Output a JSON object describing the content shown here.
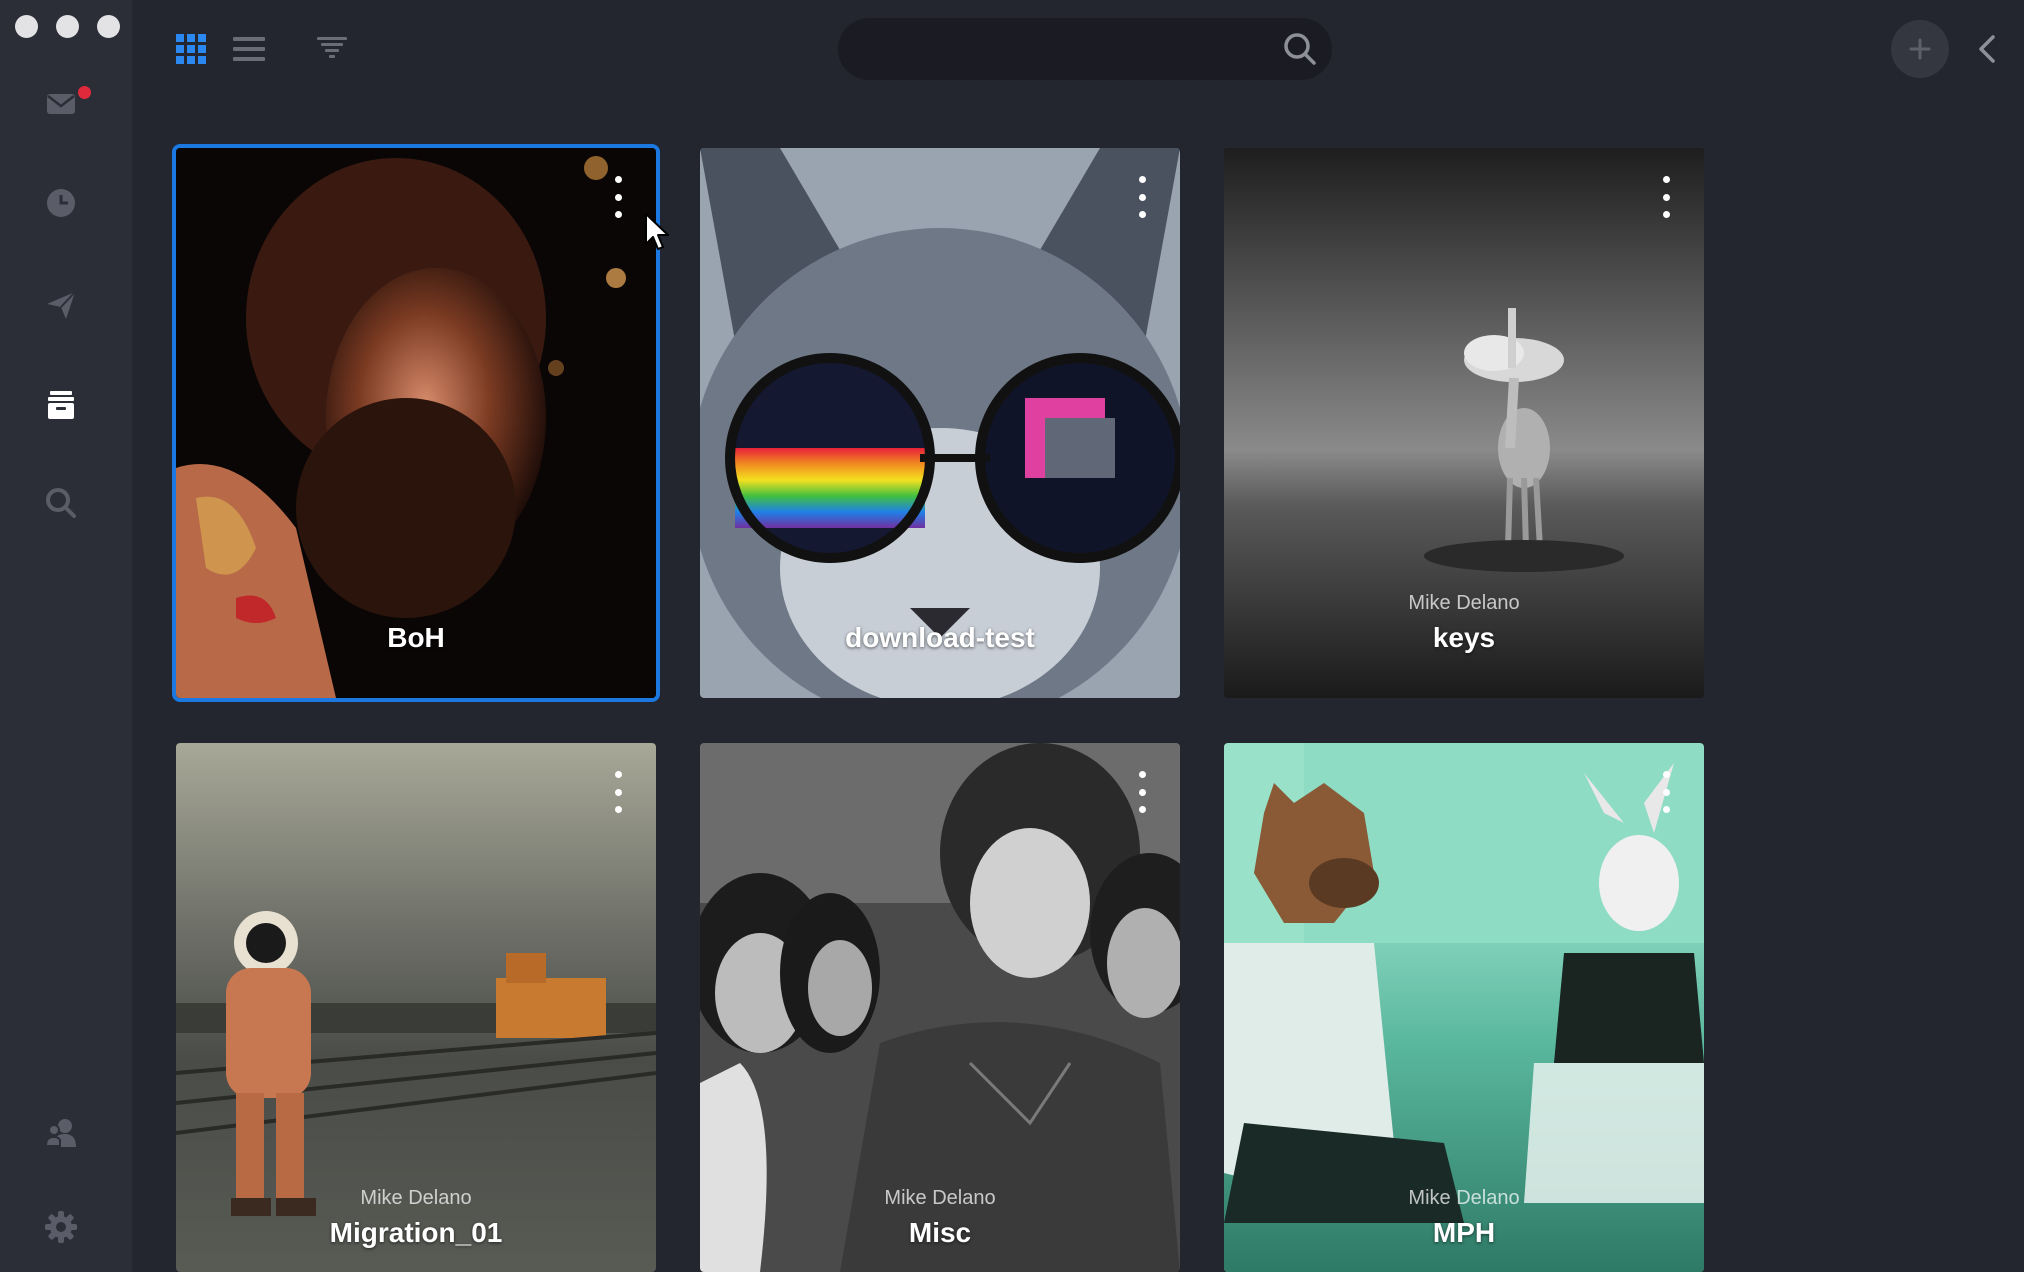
{
  "window": {
    "controls": [
      "close",
      "minimize",
      "zoom"
    ]
  },
  "sidebar": {
    "items": [
      {
        "name": "inbox",
        "icon": "mail-icon",
        "has_notification": true
      },
      {
        "name": "recent",
        "icon": "clock-icon"
      },
      {
        "name": "sent",
        "icon": "paper-plane-icon"
      },
      {
        "name": "archive",
        "icon": "archive-box-icon",
        "active": true
      },
      {
        "name": "search",
        "icon": "search-icon"
      },
      {
        "name": "contacts",
        "icon": "contacts-icon"
      },
      {
        "name": "settings",
        "icon": "gear-icon"
      }
    ]
  },
  "toolbar": {
    "view_modes": [
      {
        "name": "grid",
        "icon": "grid-icon",
        "active": true
      },
      {
        "name": "list",
        "icon": "list-icon"
      },
      {
        "name": "filter",
        "icon": "filter-icon"
      }
    ],
    "search": {
      "placeholder": "",
      "value": ""
    },
    "add_icon": "plus-icon",
    "collapse_icon": "chevron-left-icon"
  },
  "colors": {
    "background": "#23252f",
    "sidebar": "#2c2e37",
    "accent": "#1a78e0",
    "notification": "#e0293a"
  },
  "cards": [
    {
      "title": "BoH",
      "owner": "",
      "selected": true,
      "image": "bearded-man-photo"
    },
    {
      "title": "download-test",
      "owner": "",
      "selected": false,
      "image": "cat-sunglasses-photo"
    },
    {
      "title": "keys",
      "owner": "Mike Delano",
      "selected": false,
      "image": "giraffe-island-photo"
    },
    {
      "title": "Migration_01",
      "owner": "Mike Delano",
      "selected": false,
      "image": "astronaut-railway-photo"
    },
    {
      "title": "Misc",
      "owner": "Mike Delano",
      "selected": false,
      "image": "band-portrait-photo"
    },
    {
      "title": "MPH",
      "owner": "Mike Delano",
      "selected": false,
      "image": "horse-rabbit-masks-photo"
    }
  ]
}
